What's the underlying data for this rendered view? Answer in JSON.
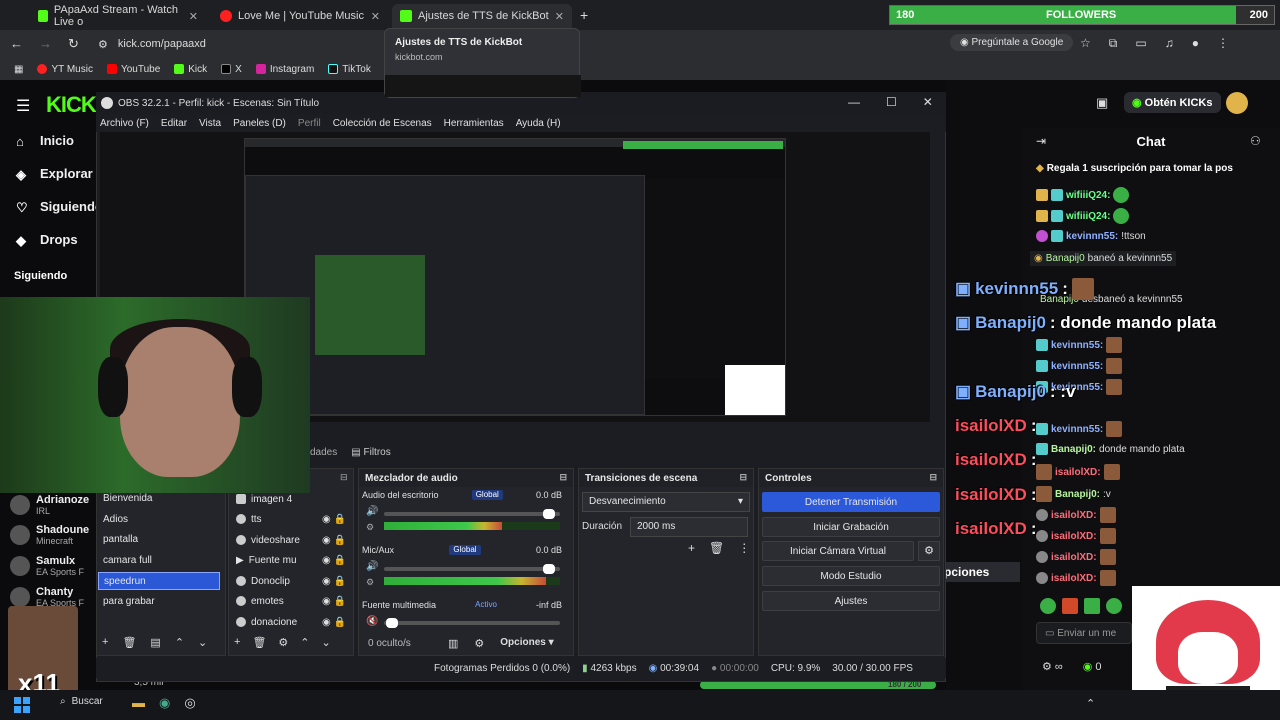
{
  "browser": {
    "tabs": [
      {
        "label": "PApaAxd Stream - Watch Live o",
        "color": "#53fc18"
      },
      {
        "label": "Love Me | YouTube Music",
        "color": "#ff2020"
      },
      {
        "label": "Ajustes de TTS de KickBot",
        "color": "#53fc18"
      }
    ],
    "url": "kick.com/papaaxd",
    "google_btn": "Pregúntale a Google",
    "bookmarks": [
      "YT Music",
      "YouTube",
      "Kick",
      "X",
      "Instagram",
      "TikTok"
    ],
    "tooltip_title": "Ajustes de TTS de KickBot",
    "tooltip_url": "kickbot.com"
  },
  "followers_bar": {
    "current": "180",
    "label": "FOLLOWERS",
    "goal": "200",
    "progress": 0.9,
    "color": "#3aaf46"
  },
  "kick": {
    "logo": "KICK",
    "nav": [
      "Inicio",
      "Explorar",
      "Siguiendo",
      "Drops"
    ],
    "following_title": "Siguiendo",
    "following": [
      {
        "name": "Adrianoze",
        "cat": "IRL"
      },
      {
        "name": "Shadoune",
        "cat": "Minecraft"
      },
      {
        "name": "Samulx",
        "cat": "EA Sports F"
      },
      {
        "name": "Chanty",
        "cat": "EA Sports F"
      }
    ],
    "viewers": "3,5 mil",
    "get_kicks": "Obtén KICKs",
    "chat_title": "Chat",
    "gift_banner": "Regala 1 suscripción para tomar la pos",
    "chat_msgs": [
      {
        "user": "wifiiiQ24:",
        "text": ""
      },
      {
        "user": "wifiiiQ24:",
        "text": ""
      },
      {
        "user": "kevinnn55:",
        "text": "!ttson"
      },
      {
        "user": "Banapij0",
        "text": "baneó a kevinnn55"
      },
      {
        "user": "Banapij0",
        "text": "desbaneó a kevinnn55"
      },
      {
        "user": "kevinnn55:",
        "text": ""
      },
      {
        "user": "kevinnn55:",
        "text": ""
      },
      {
        "user": "kevinnn55:",
        "text": ""
      },
      {
        "user": "kevinnn55:",
        "text": ""
      },
      {
        "user": "Banapij0:",
        "text": "donde mando plata"
      },
      {
        "user": "isailolXD:",
        "text": ""
      },
      {
        "user": "Banapij0:",
        "text": ":v"
      },
      {
        "user": "isailolXD:",
        "text": ""
      },
      {
        "user": "isailolXD:",
        "text": ""
      },
      {
        "user": "isailolXD:",
        "text": ""
      },
      {
        "user": "isailolXD:",
        "text": ""
      }
    ],
    "chat_input": "Enviar un me",
    "opciones": "pciones",
    "kicks_count": "0",
    "bottom_bar": "180 / 200"
  },
  "overlay": {
    "lines": [
      {
        "user": "kevinnn55",
        "text": ":"
      },
      {
        "user": "Banapij0",
        "text": ": donde mando plata"
      },
      {
        "user": "Banapij0",
        "text": ": :v"
      },
      {
        "user": "isailolXD",
        "text": ":"
      },
      {
        "user": "isailolXD",
        "text": ":"
      },
      {
        "user": "isailolXD",
        "text": ":"
      },
      {
        "user": "isailolXD",
        "text": ":"
      }
    ],
    "meme_text": "x11"
  },
  "obs": {
    "title": "OBS 32.2.1 - Perfil: kick - Escenas: Sin Título",
    "menu": [
      "Archivo (F)",
      "Editar",
      "Vista",
      "Paneles (D)",
      "Perfil",
      "Colección de Escenas",
      "Herramientas",
      "Ayuda (H)"
    ],
    "bottom_tabs": [
      "dades",
      "Filtros"
    ],
    "scenes": [
      "Bienvenida",
      "Adios",
      "pantalla",
      "camara full",
      "speedrun",
      "para grabar"
    ],
    "selected_scene": "speedrun",
    "sources": [
      "imagen 4",
      "tts",
      "videoshare",
      "Fuente mu",
      "Donoclip",
      "emotes",
      "donacione"
    ],
    "mixer": {
      "title": "Mezclador de audio",
      "channels": [
        {
          "name": "Audio del escritorio",
          "tag": "Global",
          "db": "0.0 dB",
          "level": 0.67,
          "vol": 0.96
        },
        {
          "name": "Mic/Aux",
          "tag": "Global",
          "db": "0.0 dB",
          "level": 0.92,
          "vol": 0.96
        },
        {
          "name": "Fuente multimedia",
          "tag": "Activo",
          "db": "-inf dB",
          "level": 0.0,
          "vol": 0.05
        }
      ],
      "hidden": "0 oculto/s",
      "options": "Opciones"
    },
    "transitions": {
      "title": "Transiciones de escena",
      "selected": "Desvanecimiento",
      "duration_label": "Duración",
      "duration": "2000 ms"
    },
    "controls": {
      "title": "Controles",
      "buttons": [
        "Detener Transmisión",
        "Iniciar Grabación",
        "Iniciar Cámara Virtual",
        "Modo Estudio",
        "Ajustes"
      ]
    },
    "status": {
      "dropped": "Fotogramas Perdidos 0 (0.0%)",
      "bitrate": "4263 kbps",
      "live": "00:39:04",
      "rec": "00:00:00",
      "cpu": "CPU: 9.9%",
      "fps": "30.00 / 30.00 FPS"
    }
  },
  "taskbar": {
    "search": "Buscar"
  }
}
